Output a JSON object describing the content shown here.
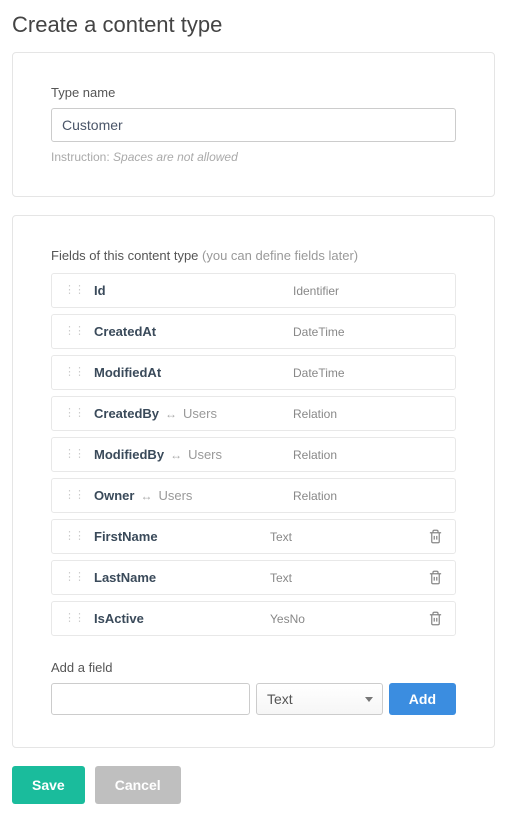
{
  "page": {
    "title": "Create a content type"
  },
  "typeName": {
    "label": "Type name",
    "value": "Customer",
    "instructionPrefix": "Instruction: ",
    "instructionText": "Spaces are not allowed"
  },
  "fieldsSection": {
    "header": "Fields of this content type ",
    "headerMuted": "(you can define fields later)",
    "rows": [
      {
        "name": "Id",
        "type": "Identifier",
        "relation": null,
        "deletable": false
      },
      {
        "name": "CreatedAt",
        "type": "DateTime",
        "relation": null,
        "deletable": false
      },
      {
        "name": "ModifiedAt",
        "type": "DateTime",
        "relation": null,
        "deletable": false
      },
      {
        "name": "CreatedBy",
        "type": "Relation",
        "relation": "Users",
        "deletable": false
      },
      {
        "name": "ModifiedBy",
        "type": "Relation",
        "relation": "Users",
        "deletable": false
      },
      {
        "name": "Owner",
        "type": "Relation",
        "relation": "Users",
        "deletable": false
      },
      {
        "name": "FirstName",
        "type": "Text",
        "relation": null,
        "deletable": true
      },
      {
        "name": "LastName",
        "type": "Text",
        "relation": null,
        "deletable": true
      },
      {
        "name": "IsActive",
        "type": "YesNo",
        "relation": null,
        "deletable": true
      }
    ]
  },
  "addField": {
    "label": "Add a field",
    "nameValue": "",
    "typeValue": "Text",
    "buttonLabel": "Add"
  },
  "footer": {
    "save": "Save",
    "cancel": "Cancel"
  },
  "glyphs": {
    "relationArrow": "↔",
    "dragDots": "⋮⋮"
  }
}
